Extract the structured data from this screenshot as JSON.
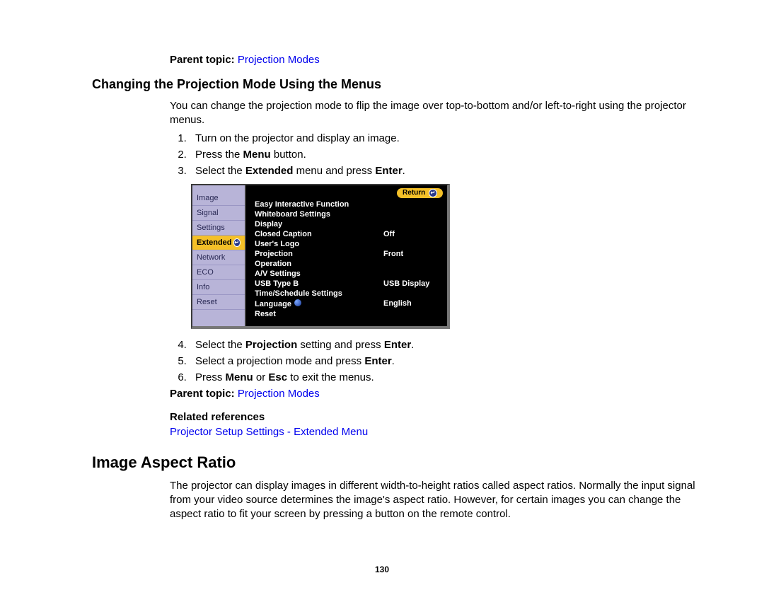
{
  "parent_topic_label": "Parent topic:",
  "parent_topic_link": "Projection Modes",
  "section1_heading": "Changing the Projection Mode Using the Menus",
  "section1_intro": "You can change the projection mode to flip the image over top-to-bottom and/or left-to-right using the projector menus.",
  "steps_top": [
    {
      "pre": "Turn on the projector and display an image."
    },
    {
      "pre": "Press the ",
      "bold": "Menu",
      "post": " button."
    },
    {
      "pre": "Select the ",
      "bold": "Extended",
      "post": " menu and press ",
      "bold2": "Enter",
      "post2": "."
    }
  ],
  "steps_bottom": [
    {
      "pre": "Select the ",
      "bold": "Projection",
      "post": " setting and press ",
      "bold2": "Enter",
      "post2": "."
    },
    {
      "pre": "Select a projection mode and press ",
      "bold": "Enter",
      "post": "."
    },
    {
      "pre": "Press ",
      "bold": "Menu",
      "post": " or ",
      "bold2": "Esc",
      "post2": " to exit the menus."
    }
  ],
  "related_heading": "Related references",
  "related_link": "Projector Setup Settings - Extended Menu",
  "section2_heading": "Image Aspect Ratio",
  "section2_body": "The projector can display images in different width-to-height ratios called aspect ratios. Normally the input signal from your video source determines the image's aspect ratio. However, for certain images you can change the aspect ratio to fit your screen by pressing a button on the remote control.",
  "page_number": "130",
  "menu": {
    "return_label": "Return",
    "tabs": [
      "Image",
      "Signal",
      "Settings",
      "Extended",
      "Network",
      "ECO",
      "Info",
      "Reset"
    ],
    "selected_tab": "Extended",
    "rows": [
      {
        "k": "Easy Interactive Function",
        "v": ""
      },
      {
        "k": "Whiteboard Settings",
        "v": ""
      },
      {
        "k": "Display",
        "v": ""
      },
      {
        "k": "Closed Caption",
        "v": "Off"
      },
      {
        "k": "User's Logo",
        "v": ""
      },
      {
        "k": "Projection",
        "v": "Front"
      },
      {
        "k": "Operation",
        "v": ""
      },
      {
        "k": "A/V Settings",
        "v": ""
      },
      {
        "k": "USB Type B",
        "v": "USB Display"
      },
      {
        "k": "Time/Schedule Settings",
        "v": ""
      },
      {
        "k": "Language",
        "v": "English",
        "globe": true
      },
      {
        "k": "Reset",
        "v": ""
      }
    ]
  }
}
